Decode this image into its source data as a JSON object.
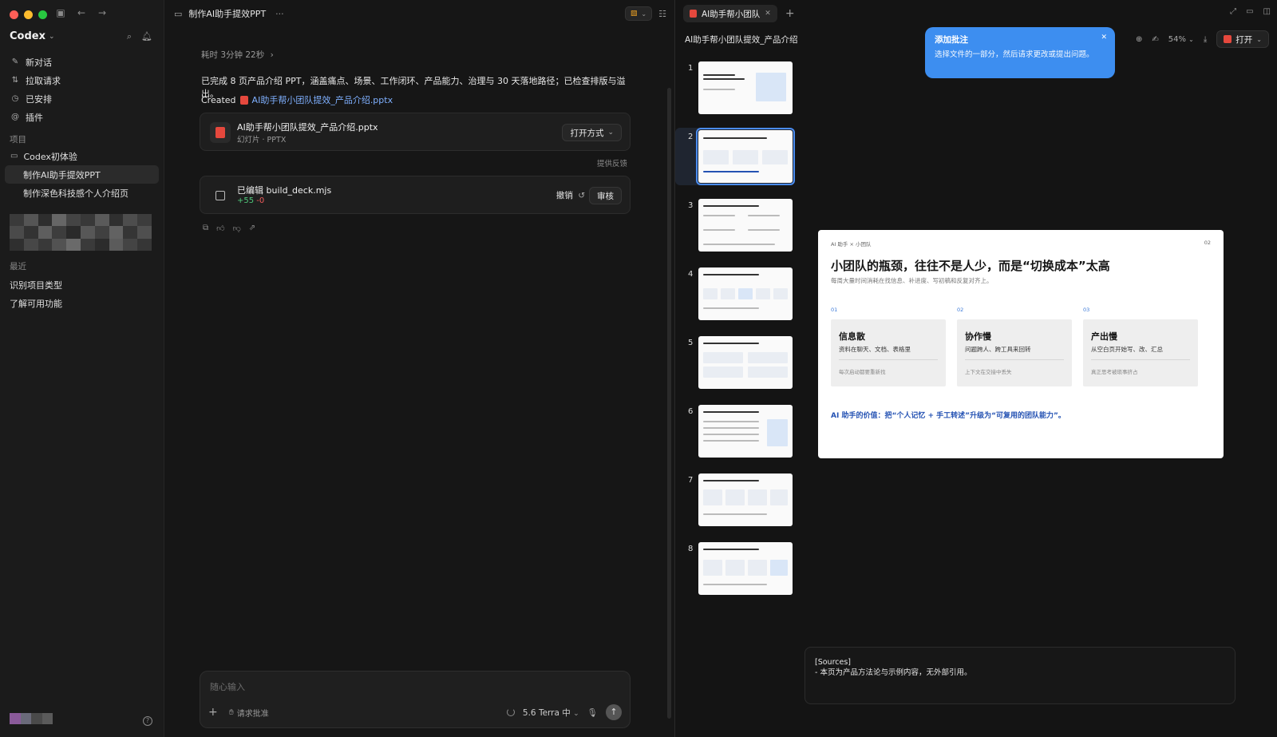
{
  "sidebar": {
    "brand": "Codex",
    "nav": [
      {
        "label": "新对话",
        "icon": "edit-icon"
      },
      {
        "label": "拉取请求",
        "icon": "pull-request-icon"
      },
      {
        "label": "已安排",
        "icon": "clock-icon"
      },
      {
        "label": "插件",
        "icon": "plugin-icon"
      }
    ],
    "projects_label": "项目",
    "project_name": "Codex初体验",
    "project_items": [
      "制作AI助手提效PPT",
      "制作深色科技感个人介绍页"
    ],
    "recent_label": "最近",
    "recent_items": [
      "识别项目类型",
      "了解可用功能"
    ]
  },
  "chat": {
    "title": "制作AI助手提效PPT",
    "elapsed": "耗时 3分钟 22秒",
    "summary": "已完成 8 页产品介绍 PPT，涵盖痛点、场景、工作闭环、产品能力、治理与 30 天落地路径；已检查排版与溢出。",
    "created_prefix": "Created",
    "created_file": "AI助手帮小团队提效_产品介绍.pptx",
    "file_card": {
      "name": "AI助手帮小团队提效_产品介绍.pptx",
      "type": "幻灯片 · PPTX",
      "open_label": "打开方式"
    },
    "feedback": "提供反馈",
    "edit_card": {
      "title": "已编辑 build_deck.mjs",
      "added": "+55",
      "removed": "-0",
      "undo": "撤销",
      "review": "审核"
    },
    "composer": {
      "placeholder": "随心输入",
      "request": "请求批准",
      "model": "5.6 Terra 中"
    }
  },
  "preview": {
    "tab_label": "AI助手帮小团队",
    "doc_title": "AI助手帮小团队提效_产品介绍",
    "zoom": "54%",
    "open_label": "打开",
    "tooltip": {
      "title": "添加批注",
      "body": "选择文件的一部分，然后请求更改或提出问题。"
    },
    "thumbnails": [
      "1",
      "2",
      "3",
      "4",
      "5",
      "6",
      "7",
      "8"
    ],
    "active_thumb": 2,
    "slide": {
      "kicker": "AI 助手 × 小团队",
      "page": "02",
      "title": "小团队的瓶颈，往往不是人少，而是“切换成本”太高",
      "subtitle": "每周大量时间消耗在找信息、补进度、写初稿和反复对齐上。",
      "columns": [
        {
          "num": "01",
          "head": "信息散",
          "desc": "资料在聊天、文档、表格里",
          "note": "每次启动都要重新找"
        },
        {
          "num": "02",
          "head": "协作慢",
          "desc": "问题跨人、跨工具来回转",
          "note": "上下文在交接中丢失"
        },
        {
          "num": "03",
          "head": "产出慢",
          "desc": "从空白页开始写、改、汇总",
          "note": "真正思考被琐事挤占"
        }
      ],
      "value": "AI 助手的价值：把“个人记忆 + 手工转述”升级为“可复用的团队能力”。"
    },
    "notes": {
      "line1": "[Sources]",
      "line2": "- 本页为产品方法论与示例内容，无外部引用。"
    }
  }
}
